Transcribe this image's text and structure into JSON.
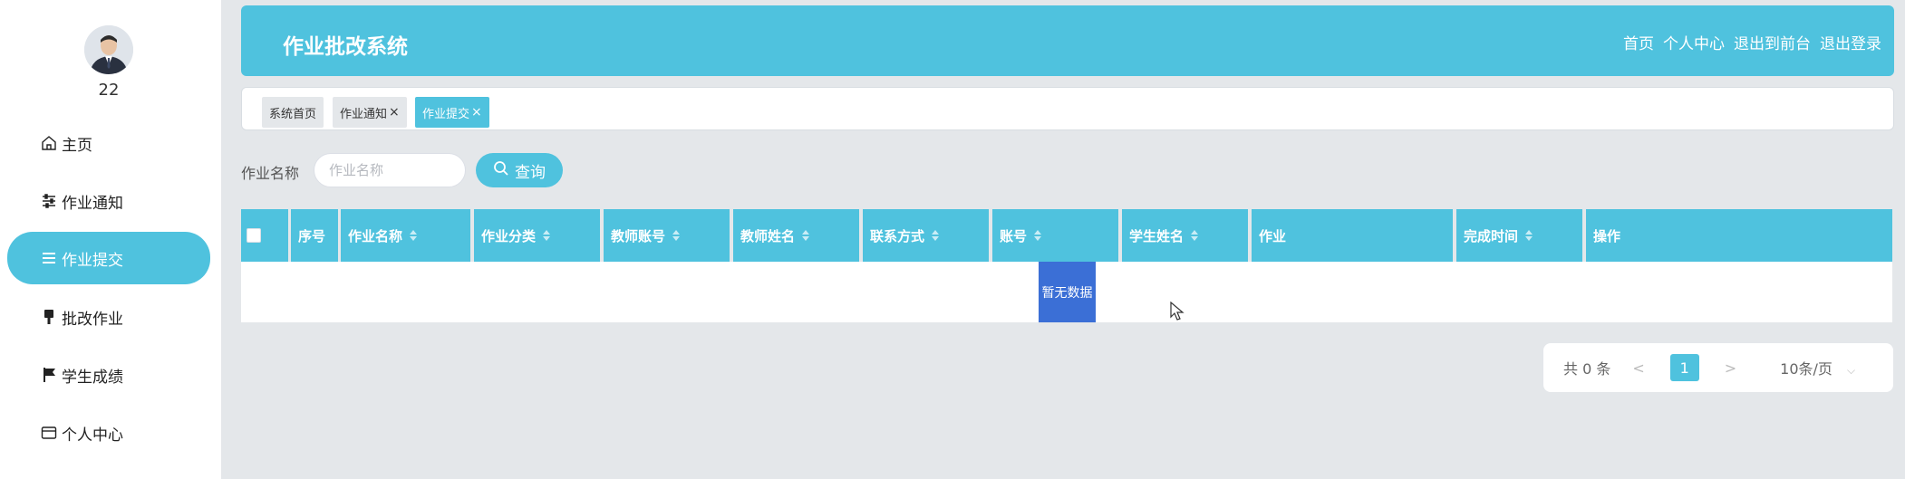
{
  "user": {
    "name": "22"
  },
  "sidebar": {
    "items": [
      {
        "label": "主页",
        "icon": "home-icon",
        "active": false
      },
      {
        "label": "作业通知",
        "icon": "sliders-icon",
        "active": false
      },
      {
        "label": "作业提交",
        "icon": "list-icon",
        "active": true
      },
      {
        "label": "批改作业",
        "icon": "brush-icon",
        "active": false
      },
      {
        "label": "学生成绩",
        "icon": "flag-icon",
        "active": false
      },
      {
        "label": "个人中心",
        "icon": "card-icon",
        "active": false
      }
    ]
  },
  "header": {
    "title": "作业批改系统",
    "nav": [
      "首页",
      "个人中心",
      "退出到前台",
      "退出登录"
    ]
  },
  "tabs": [
    {
      "label": "系统首页",
      "closable": false,
      "active": false
    },
    {
      "label": "作业通知",
      "closable": true,
      "active": false
    },
    {
      "label": "作业提交",
      "closable": true,
      "active": true
    }
  ],
  "search": {
    "label": "作业名称",
    "placeholder": "作业名称",
    "value": "",
    "button_label": "查询"
  },
  "table": {
    "columns": [
      {
        "label": "",
        "type": "checkbox",
        "sortable": false
      },
      {
        "label": "序号",
        "sortable": false
      },
      {
        "label": "作业名称",
        "sortable": true
      },
      {
        "label": "作业分类",
        "sortable": true
      },
      {
        "label": "教师账号",
        "sortable": true
      },
      {
        "label": "教师姓名",
        "sortable": true
      },
      {
        "label": "联系方式",
        "sortable": true
      },
      {
        "label": "账号",
        "sortable": true
      },
      {
        "label": "学生姓名",
        "sortable": true
      },
      {
        "label": "作业",
        "sortable": false
      },
      {
        "label": "完成时间",
        "sortable": true
      },
      {
        "label": "操作",
        "sortable": false
      }
    ],
    "rows": [],
    "empty_text": "暂无数据"
  },
  "pagination": {
    "total_text": "共 0 条",
    "prev": "<",
    "current_page": "1",
    "next": ">",
    "page_size": "10条/页"
  },
  "colors": {
    "accent": "#4fc2de",
    "background": "#e4e7ea",
    "empty_highlight": "#3b6fd6"
  }
}
